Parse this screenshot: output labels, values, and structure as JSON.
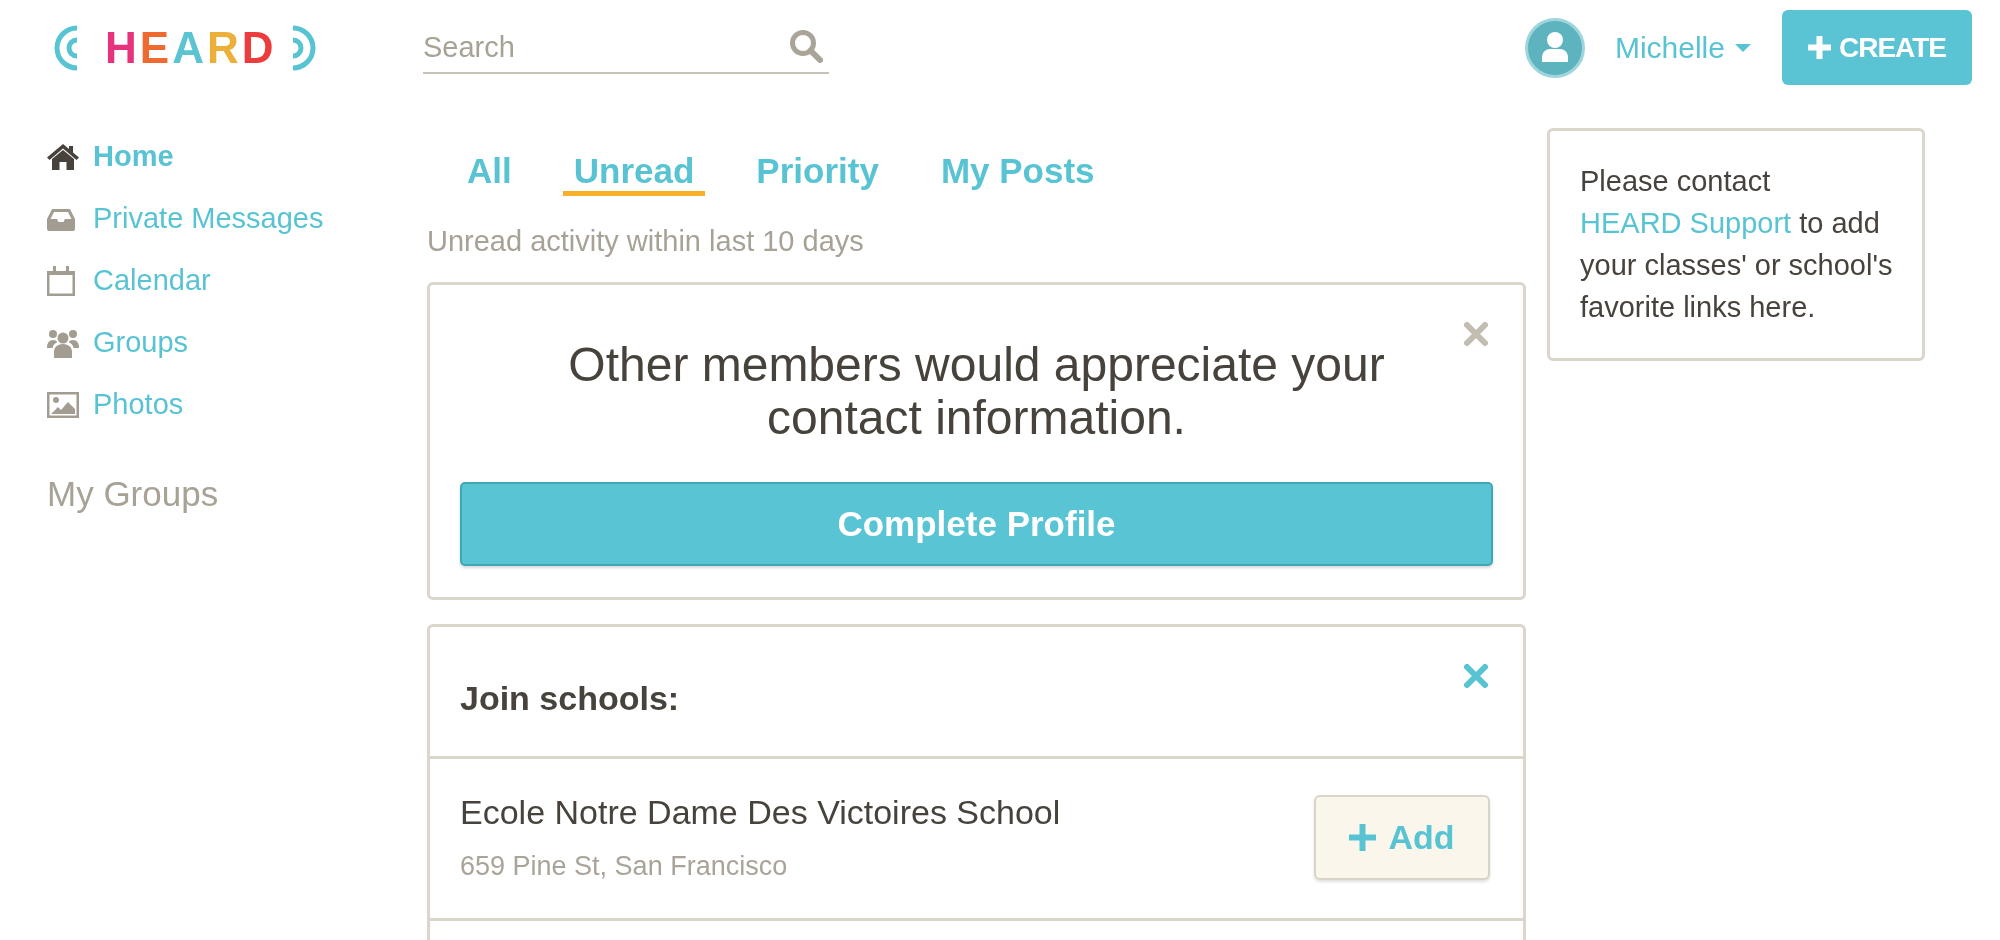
{
  "header": {
    "logo": {
      "letters": [
        {
          "letter": "H",
          "color": "#e5347c"
        },
        {
          "letter": "E",
          "color": "#ef6a31"
        },
        {
          "letter": "A",
          "color": "#5ac4d3"
        },
        {
          "letter": "R",
          "color": "#ecb03a"
        },
        {
          "letter": "D",
          "color": "#ec3c3e"
        }
      ]
    },
    "search": {
      "placeholder": "Search"
    },
    "user": {
      "name": "Michelle"
    },
    "create_button": {
      "label": "CREATE"
    }
  },
  "sidebar": {
    "items": [
      {
        "label": "Home",
        "kind": "home",
        "selected": true
      },
      {
        "label": "Private Messages",
        "kind": "inbox",
        "selected": false
      },
      {
        "label": "Calendar",
        "kind": "calendar",
        "selected": false
      },
      {
        "label": "Groups",
        "kind": "groups",
        "selected": false
      },
      {
        "label": "Photos",
        "kind": "photos",
        "selected": false
      }
    ],
    "section_title": "My Groups"
  },
  "tabs": [
    {
      "label": "All",
      "selected": false
    },
    {
      "label": "Unread",
      "selected": true
    },
    {
      "label": "Priority",
      "selected": false
    },
    {
      "label": "My Posts",
      "selected": false
    }
  ],
  "feed": {
    "caption": "Unread activity within last 10 days",
    "cards": [
      {
        "kind": "prompt",
        "message": "Other members would appreciate your contact information.",
        "button": "Complete Profile"
      },
      {
        "kind": "suggestions",
        "title": "Join schools:",
        "schools": [
          {
            "name": "Ecole Notre Dame Des Victoires School",
            "address": "659 Pine St, San Francisco",
            "button": "Add"
          }
        ]
      }
    ]
  },
  "links_panel": {
    "text_before": "Please contact",
    "link": "HEARD Support",
    "text_after": "to add your classes' or school's favorite links here."
  }
}
